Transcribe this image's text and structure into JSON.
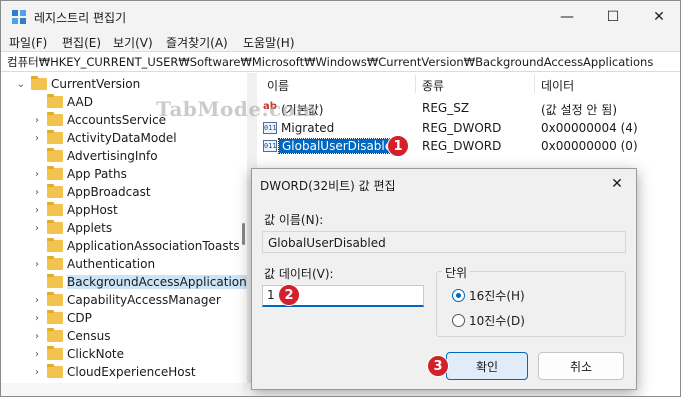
{
  "window": {
    "title": "레지스트리 편집기",
    "minimize": "—",
    "maximize": "☐",
    "close": "✕"
  },
  "menu": [
    "파일(F)",
    "편집(E)",
    "보기(V)",
    "즐겨찾기(A)",
    "도움말(H)"
  ],
  "address": "컴퓨터₩HKEY_CURRENT_USER₩Software₩Microsoft₩Windows₩CurrentVersion₩BackgroundAccessApplications",
  "tree": [
    {
      "label": "CurrentVersion",
      "expanded": true
    },
    {
      "label": "AAD"
    },
    {
      "label": "AccountsService"
    },
    {
      "label": "ActivityDataModel"
    },
    {
      "label": "AdvertisingInfo"
    },
    {
      "label": "App Paths"
    },
    {
      "label": "AppBroadcast"
    },
    {
      "label": "AppHost"
    },
    {
      "label": "Applets"
    },
    {
      "label": "ApplicationAssociationToasts"
    },
    {
      "label": "Authentication"
    },
    {
      "label": "BackgroundAccessApplications",
      "selected": true
    },
    {
      "label": "CapabilityAccessManager"
    },
    {
      "label": "CDP"
    },
    {
      "label": "Census"
    },
    {
      "label": "ClickNote"
    },
    {
      "label": "CloudExperienceHost"
    }
  ],
  "list": {
    "headers": [
      "이름",
      "종류",
      "데이터"
    ],
    "rows": [
      {
        "name": "(기본값)",
        "type": "REG_SZ",
        "data": "(값 설정 안 됨)",
        "icon": "string-value-icon"
      },
      {
        "name": "Migrated",
        "type": "REG_DWORD",
        "data": "0x00000004 (4)",
        "icon": "dword-value-icon"
      },
      {
        "name": "GlobalUserDisabled",
        "type": "REG_DWORD",
        "data": "0x00000000 (0)",
        "icon": "dword-value-icon"
      }
    ]
  },
  "watermark": "TabMode.com",
  "badges": [
    "1",
    "2",
    "3"
  ],
  "dialog": {
    "title": "DWORD(32비트) 값 편집",
    "close": "✕",
    "name_label": "값 이름(N):",
    "name_value": "GlobalUserDisabled",
    "data_label": "값 데이터(V):",
    "data_value": "1",
    "base_label": "단위",
    "hex_label": "16진수(H)",
    "dec_label": "10진수(D)",
    "ok_label": "확인",
    "cancel_label": "취소"
  }
}
